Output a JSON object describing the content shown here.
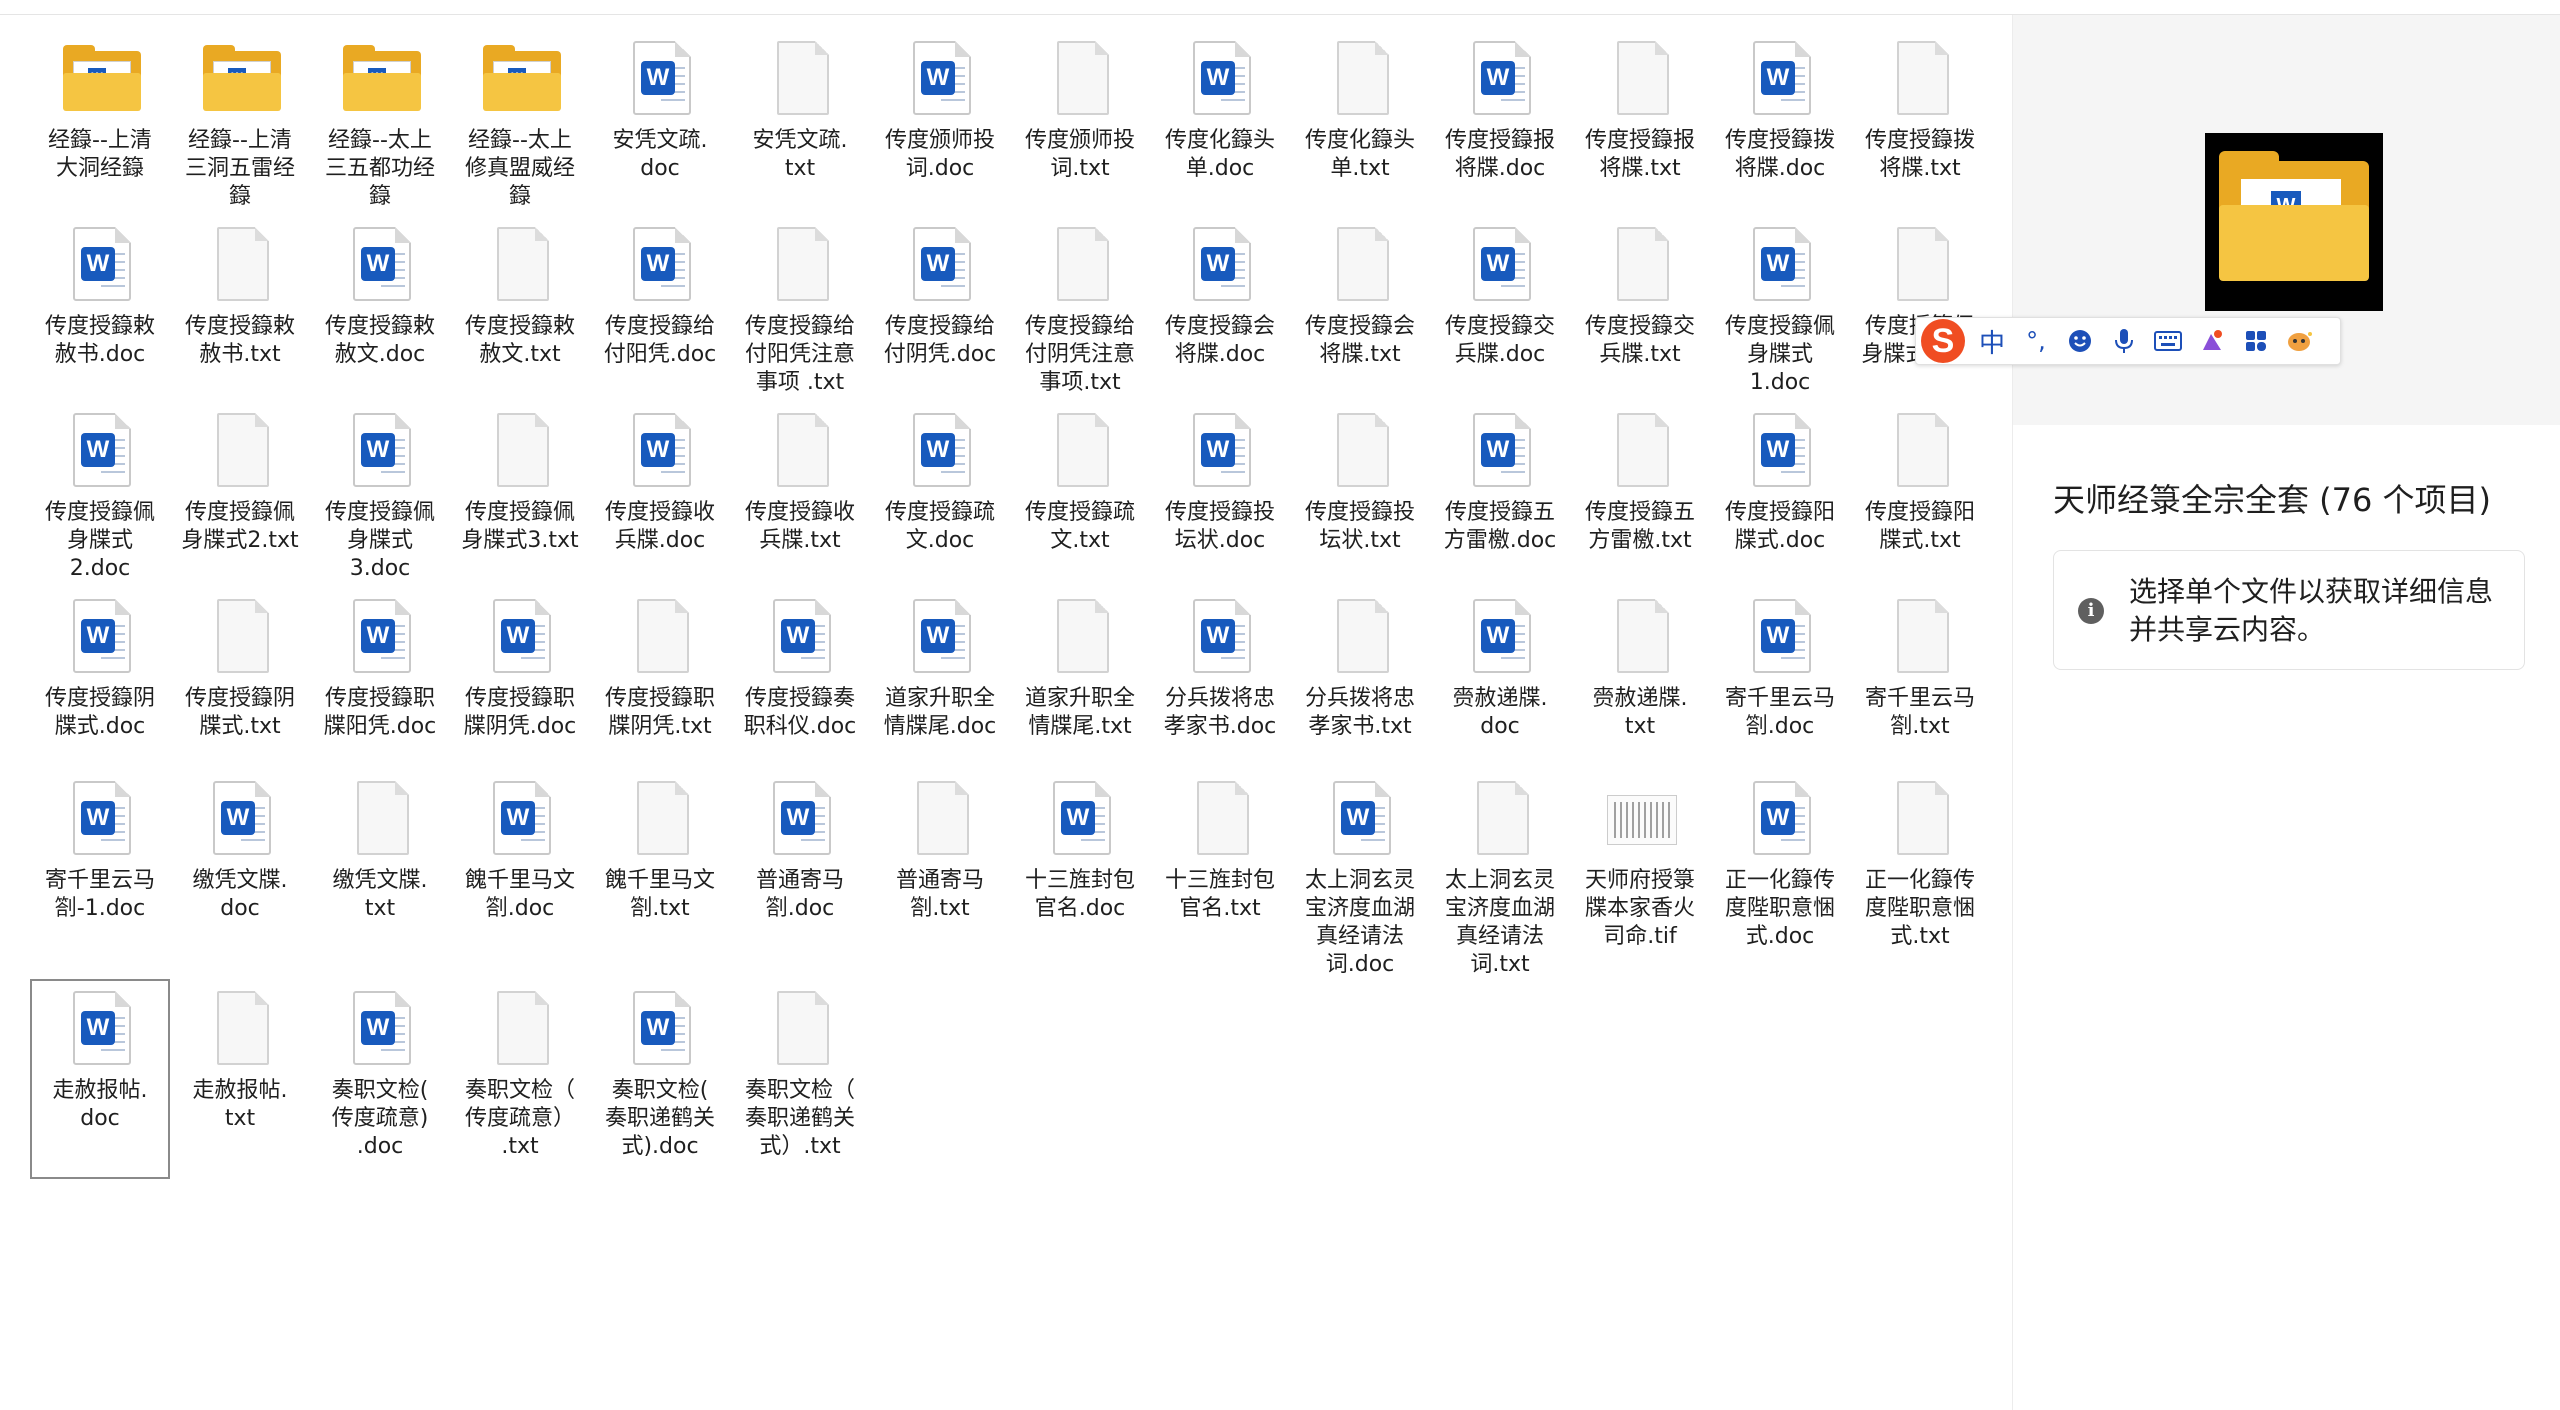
{
  "files": [
    {
      "name": "经籙--上清\n大洞经籙",
      "type": "folder"
    },
    {
      "name": "经籙--上清\n三洞五雷经\n籙",
      "type": "folder"
    },
    {
      "name": "经籙--太上\n三五都功经\n籙",
      "type": "folder"
    },
    {
      "name": "经籙--太上\n修真盟威经\n籙",
      "type": "folder"
    },
    {
      "name": "安凭文疏.\ndoc",
      "type": "doc"
    },
    {
      "name": "安凭文疏.\ntxt",
      "type": "txt"
    },
    {
      "name": "传度颁师投\n词.doc",
      "type": "doc"
    },
    {
      "name": "传度颁师投\n词.txt",
      "type": "txt"
    },
    {
      "name": "传度化籙头\n单.doc",
      "type": "doc"
    },
    {
      "name": "传度化籙头\n单.txt",
      "type": "txt"
    },
    {
      "name": "传度授籙报\n将牒.doc",
      "type": "doc"
    },
    {
      "name": "传度授籙报\n将牒.txt",
      "type": "txt"
    },
    {
      "name": "传度授籙拨\n将牒.doc",
      "type": "doc"
    },
    {
      "name": "传度授籙拨\n将牒.txt",
      "type": "txt"
    },
    {
      "name": "传度授籙敕\n赦书.doc",
      "type": "doc"
    },
    {
      "name": "传度授籙敕\n赦书.txt",
      "type": "txt"
    },
    {
      "name": "传度授籙敕\n赦文.doc",
      "type": "doc"
    },
    {
      "name": "传度授籙敕\n赦文.txt",
      "type": "txt"
    },
    {
      "name": "传度授籙给\n付阳凭.doc",
      "type": "doc"
    },
    {
      "name": "传度授籙给\n付阳凭注意\n事项 .txt",
      "type": "txt"
    },
    {
      "name": "传度授籙给\n付阴凭.doc",
      "type": "doc"
    },
    {
      "name": "传度授籙给\n付阴凭注意\n事项.txt",
      "type": "txt"
    },
    {
      "name": "传度授籙会\n将牒.doc",
      "type": "doc"
    },
    {
      "name": "传度授籙会\n将牒.txt",
      "type": "txt"
    },
    {
      "name": "传度授籙交\n兵牒.doc",
      "type": "doc"
    },
    {
      "name": "传度授籙交\n兵牒.txt",
      "type": "txt"
    },
    {
      "name": "传度授籙佩\n身牒式\n1.doc",
      "type": "doc"
    },
    {
      "name": "传度授籙佩\n身牒式1.txt",
      "type": "txt"
    },
    {
      "name": "传度授籙佩\n身牒式\n2.doc",
      "type": "doc"
    },
    {
      "name": "传度授籙佩\n身牒式2.txt",
      "type": "txt"
    },
    {
      "name": "传度授籙佩\n身牒式\n3.doc",
      "type": "doc"
    },
    {
      "name": "传度授籙佩\n身牒式3.txt",
      "type": "txt"
    },
    {
      "name": "传度授籙收\n兵牒.doc",
      "type": "doc"
    },
    {
      "name": "传度授籙收\n兵牒.txt",
      "type": "txt"
    },
    {
      "name": "传度授籙疏\n文.doc",
      "type": "doc"
    },
    {
      "name": "传度授籙疏\n文.txt",
      "type": "txt"
    },
    {
      "name": "传度授籙投\n坛状.doc",
      "type": "doc"
    },
    {
      "name": "传度授籙投\n坛状.txt",
      "type": "txt"
    },
    {
      "name": "传度授籙五\n方雷檄.doc",
      "type": "doc"
    },
    {
      "name": "传度授籙五\n方雷檄.txt",
      "type": "txt"
    },
    {
      "name": "传度授籙阳\n牒式.doc",
      "type": "doc"
    },
    {
      "name": "传度授籙阳\n牒式.txt",
      "type": "txt"
    },
    {
      "name": "传度授籙阴\n牒式.doc",
      "type": "doc"
    },
    {
      "name": "传度授籙阴\n牒式.txt",
      "type": "txt"
    },
    {
      "name": "传度授籙职\n牒阳凭.doc",
      "type": "doc"
    },
    {
      "name": "传度授籙职\n牒阴凭.doc",
      "type": "doc"
    },
    {
      "name": "传度授籙职\n牒阴凭.txt",
      "type": "txt"
    },
    {
      "name": "传度授籙奏\n职科仪.doc",
      "type": "doc"
    },
    {
      "name": "道家升职全\n情牒尾.doc",
      "type": "doc"
    },
    {
      "name": "道家升职全\n情牒尾.txt",
      "type": "txt"
    },
    {
      "name": "分兵拨将忠\n孝家书.doc",
      "type": "doc"
    },
    {
      "name": "分兵拨将忠\n孝家书.txt",
      "type": "txt"
    },
    {
      "name": "赍赦递牒.\ndoc",
      "type": "doc"
    },
    {
      "name": "赍赦递牒.\ntxt",
      "type": "txt"
    },
    {
      "name": "寄千里云马\n劄.doc",
      "type": "doc"
    },
    {
      "name": "寄千里云马\n劄.txt",
      "type": "txt"
    },
    {
      "name": "寄千里云马\n劄-1.doc",
      "type": "doc"
    },
    {
      "name": "缴凭文牒.\ndoc",
      "type": "doc"
    },
    {
      "name": "缴凭文牒.\ntxt",
      "type": "txt"
    },
    {
      "name": "餽千里马文\n劄.doc",
      "type": "doc"
    },
    {
      "name": "餽千里马文\n劄.txt",
      "type": "txt"
    },
    {
      "name": "普通寄马\n劄.doc",
      "type": "doc"
    },
    {
      "name": "普通寄马\n劄.txt",
      "type": "txt"
    },
    {
      "name": "十三旌封包\n官名.doc",
      "type": "doc"
    },
    {
      "name": "十三旌封包\n官名.txt",
      "type": "txt"
    },
    {
      "name": "太上洞玄灵\n宝济度血湖\n真经请法\n词.doc",
      "type": "doc"
    },
    {
      "name": "太上洞玄灵\n宝济度血湖\n真经请法\n词.txt",
      "type": "txt"
    },
    {
      "name": "天师府授箓\n牒本家香火\n司命.tif",
      "type": "tif"
    },
    {
      "name": "正一化籙传\n度陛职意悃\n式.doc",
      "type": "doc"
    },
    {
      "name": "正一化籙传\n度陛职意悃\n式.txt",
      "type": "txt"
    },
    {
      "name": "走赦报帖.\ndoc",
      "type": "doc",
      "selected": true
    },
    {
      "name": "走赦报帖.\ntxt",
      "type": "txt"
    },
    {
      "name": "奏职文检(\n传度疏意)\n.doc",
      "type": "doc"
    },
    {
      "name": "奏职文检（\n传度疏意）\n.txt",
      "type": "txt"
    },
    {
      "name": "奏职文检(\n奏职递鹤关\n式).doc",
      "type": "doc"
    },
    {
      "name": "奏职文检（\n奏职递鹤关\n式）.txt",
      "type": "txt"
    }
  ],
  "details": {
    "folder_title": "天师经箓全宗全套 (76 个项目)",
    "info_message": "选择单个文件以获取详细信息并共享云内容。",
    "info_icon": "i"
  },
  "ime": {
    "logo": "S",
    "mode": "中",
    "punct": "°,",
    "buttons": [
      "emoji-icon",
      "microphone-icon",
      "keyboard-icon",
      "skin-icon",
      "toolbox-icon",
      "mascot-icon"
    ]
  },
  "colors": {
    "accent": "#185abd",
    "folder": "#f5c542",
    "ime_logo": "#f04d22"
  }
}
